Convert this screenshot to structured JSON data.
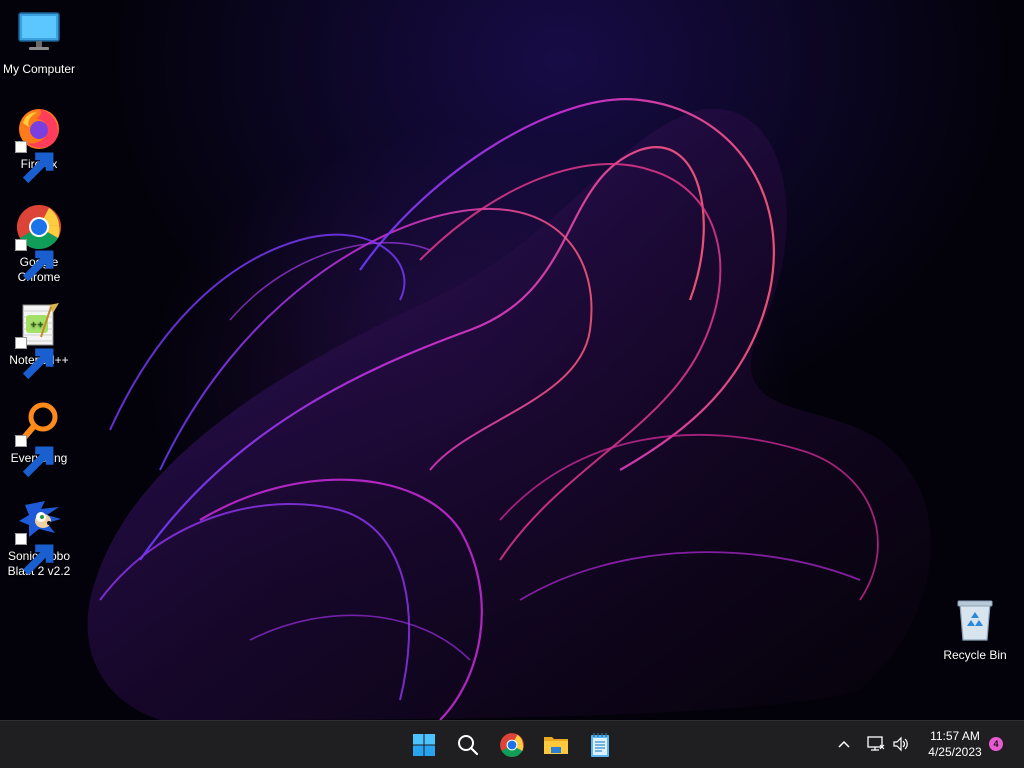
{
  "desktop": {
    "icons": [
      {
        "label": "My Computer",
        "icon": "monitor-icon",
        "shortcut": false
      },
      {
        "label": "Firefox",
        "icon": "firefox-icon",
        "shortcut": true
      },
      {
        "label": "Google Chrome",
        "icon": "chrome-icon",
        "shortcut": true
      },
      {
        "label": "Notepad++",
        "icon": "notepadpp-icon",
        "shortcut": true
      },
      {
        "label": "Everything",
        "icon": "everything-icon",
        "shortcut": true
      },
      {
        "label": "Sonic Robo Blast 2 v2.2",
        "icon": "sonic-icon",
        "shortcut": true
      },
      {
        "label": "Recycle Bin",
        "icon": "recycle-bin-icon",
        "shortcut": false
      }
    ]
  },
  "taskbar": {
    "apps": [
      {
        "name": "Start",
        "icon": "windows-start-icon"
      },
      {
        "name": "Search",
        "icon": "search-icon"
      },
      {
        "name": "Google Chrome",
        "icon": "chrome-icon"
      },
      {
        "name": "File Explorer",
        "icon": "folder-icon"
      },
      {
        "name": "Notepad",
        "icon": "notepad-icon"
      }
    ],
    "tray": {
      "icons": [
        "chevron-up-icon",
        "network-icon",
        "speaker-icon"
      ],
      "time": "11:57 AM",
      "date": "4/25/2023",
      "notification_count": "4"
    }
  },
  "colors": {
    "taskbar": "#1f1f22",
    "accent": "#0078d4",
    "wallpaper_glow": "#b42ad8",
    "notification_badge": "#e85bd0"
  }
}
